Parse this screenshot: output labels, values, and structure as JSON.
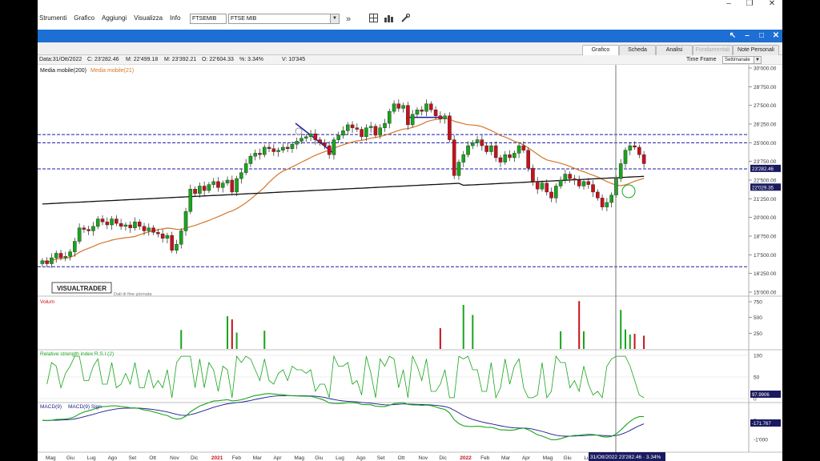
{
  "menu": [
    "Strumenti",
    "Grafico",
    "Aggiungi",
    "Visualizza",
    "Info"
  ],
  "symbol": {
    "code": "FTSEMIB",
    "name": "FTSE MIB"
  },
  "toolbar_icons": [
    "double-chevron-right-icon",
    "layout-icon",
    "bar-chart-icon",
    "tools-icon"
  ],
  "window": {
    "minimize": "–",
    "restore": "❐",
    "close": "✕"
  },
  "panel_controls": [
    "expand-arrow-icon",
    "minimize-icon",
    "maximize-icon",
    "close-icon"
  ],
  "tabs": [
    {
      "label": "Grafico",
      "active": true
    },
    {
      "label": "Scheda"
    },
    {
      "label": "Analisi"
    },
    {
      "label": "Fondamentali",
      "disabled": true
    },
    {
      "label": "Note Personali"
    }
  ],
  "info": {
    "date": "Data:31/Ott/2022",
    "close": "C: 23'282.46",
    "max": "M: 22'499.18",
    "min": "M: 23'392.21",
    "open": "O: 22'604.33",
    "pct": "%: 3.34%",
    "vol": "V: 10'345",
    "timeframe_label": "Time Frame",
    "timeframe_value": "Settimanale"
  },
  "legend": {
    "ma200": "Media mobile(200)",
    "ma21": "Media mobile(21)"
  },
  "logo": "VISUALTRADER",
  "logo_sub": "Dati di fine giornata",
  "colors": {
    "up": "#18a51b",
    "down": "#c8101a",
    "ma200": "#111111",
    "ma21": "#d4772a",
    "blue_level": "#1a1aa6",
    "accent": "#1e6fd3"
  },
  "chart_data": {
    "type": "candlestick",
    "series": "FTSE MIB weekly",
    "ylim": [
      15000,
      30000
    ],
    "yticks": [
      "30'000.00",
      "28'750.00",
      "27'500.00",
      "26'250.00",
      "25'000.00",
      "23'750.00",
      "22'500.00",
      "21'250.00",
      "20'000.00",
      "18'750.00",
      "17'500.00",
      "16'250.00",
      "15'000.00"
    ],
    "ytick_values": [
      30000,
      28750,
      27500,
      26250,
      25000,
      23750,
      22500,
      21250,
      20000,
      18750,
      17500,
      16250,
      15000
    ],
    "price_markers": [
      {
        "label": "23'282.46",
        "value": 23282
      },
      {
        "label": "22'029.35",
        "value": 22029
      }
    ],
    "x_labels": [
      "Mag",
      "Giu",
      "Lug",
      "Ago",
      "Set",
      "Ott",
      "Nov",
      "Dic",
      "2021",
      "Feb",
      "Mar",
      "Apr",
      "Mag",
      "Giu",
      "Lug",
      "Ago",
      "Set",
      "Ott",
      "Nov",
      "Dic",
      "2022",
      "Feb",
      "Mar",
      "Apr",
      "Mag",
      "Giu",
      "Lug",
      "Ago",
      "Set"
    ],
    "cursor_label": "31/Ott/2022 23'282.46 · 3.34%",
    "horizontal_levels": [
      25550,
      25000,
      23250,
      16700
    ],
    "closes": [
      17100,
      16900,
      17300,
      17600,
      17300,
      17400,
      17700,
      18400,
      19300,
      19200,
      19100,
      19400,
      19900,
      19700,
      19500,
      19900,
      19600,
      19400,
      19500,
      19300,
      19700,
      19400,
      19100,
      19300,
      19000,
      18900,
      18600,
      18800,
      17800,
      18200,
      19100,
      20400,
      21900,
      21600,
      22100,
      21800,
      22200,
      22400,
      22000,
      22300,
      22500,
      21700,
      22600,
      23000,
      23600,
      24100,
      24300,
      24200,
      24700,
      24600,
      24400,
      24500,
      24700,
      24600,
      24900,
      25100,
      25300,
      25400,
      25600,
      25200,
      25000,
      24800,
      24200,
      25200,
      25500,
      25800,
      26200,
      26000,
      25900,
      25400,
      26000,
      26100,
      25500,
      26000,
      26300,
      27100,
      27600,
      27300,
      27500,
      26200,
      26900,
      27200,
      27100,
      27600,
      27200,
      26800,
      26600,
      26800,
      25200,
      22800,
      23700,
      24200,
      24800,
      25000,
      25200,
      24800,
      24400,
      24800,
      24000,
      23700,
      24200,
      24000,
      24300,
      24800,
      24500,
      23300,
      22400,
      21900,
      22300,
      21700,
      21300,
      22100,
      22500,
      22900,
      22600,
      22500,
      22100,
      22400,
      22200,
      21700,
      21300,
      20700,
      21000,
      21500,
      22600,
      23600,
      24500,
      24800,
      24700,
      24200,
      23600
    ],
    "volume_ylim": [
      0,
      750
    ],
    "volume_ticks": [
      "750",
      "500",
      "250"
    ],
    "volume_tick_values": [
      750,
      500,
      250
    ],
    "rsi_label": "Relative strength index R.S.I.(2)",
    "rsi_ticks": [
      "100",
      "50",
      "0"
    ],
    "rsi_tick_values": [
      100,
      50,
      0
    ],
    "rsi_value_label": "97.9906",
    "macd_label": "MACD(9)",
    "macd_sign_label": "MACD(9) Sign",
    "macd_ticks": [
      "0",
      "-1'000"
    ],
    "macd_tick_values": [
      0,
      -1000
    ],
    "macd_value_label": "-171.767"
  }
}
